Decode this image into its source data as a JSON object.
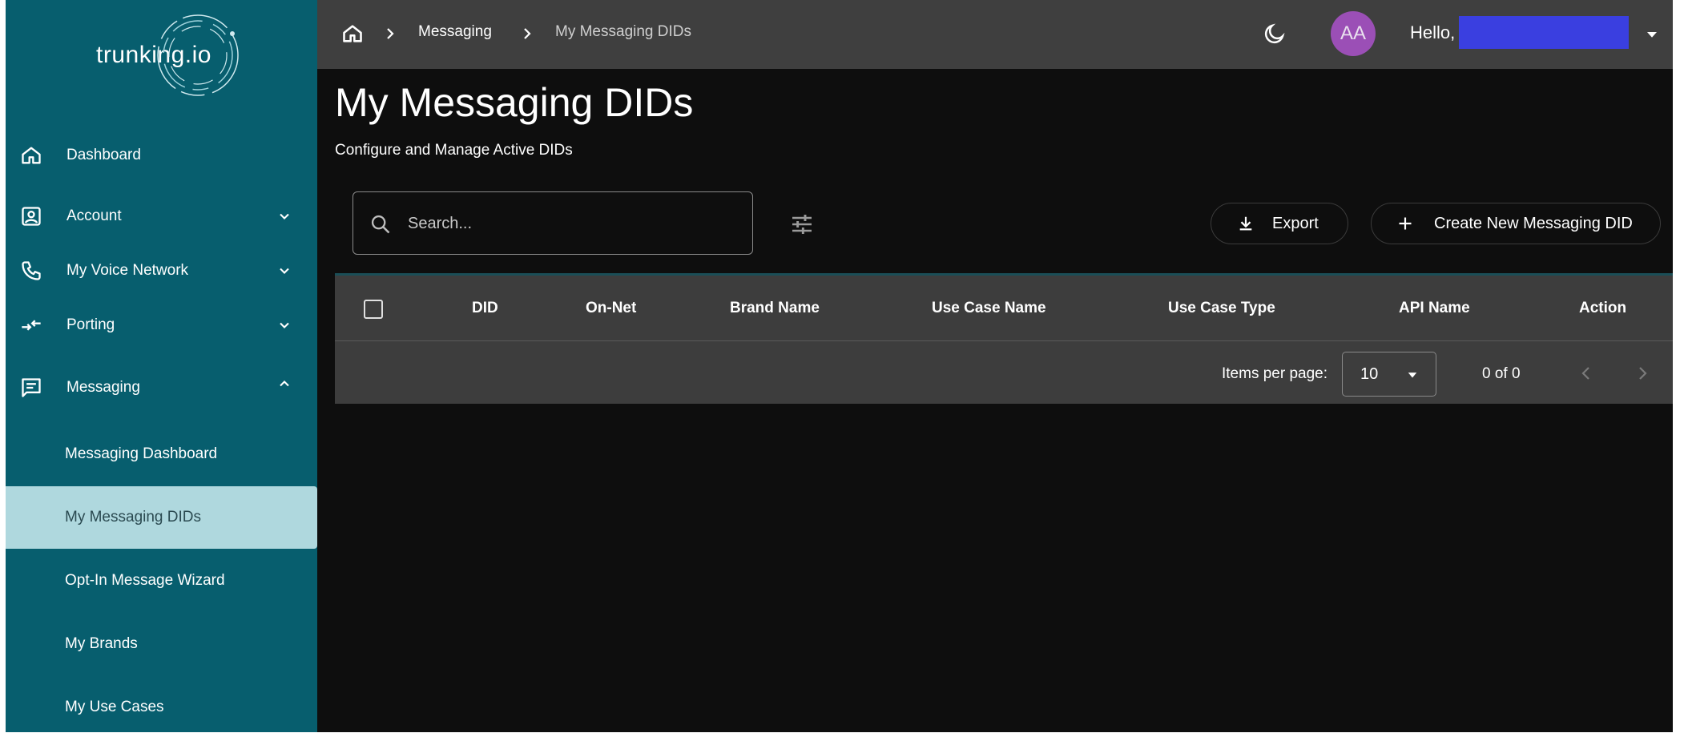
{
  "brand": {
    "logo_text": "trunking.io"
  },
  "sidebar": {
    "items": [
      {
        "label": "Dashboard",
        "icon": "home-icon"
      },
      {
        "label": "Account",
        "icon": "account-icon",
        "expandable": true,
        "expanded": false
      },
      {
        "label": "My Voice Network",
        "icon": "phone-icon",
        "expandable": true,
        "expanded": false
      },
      {
        "label": "Porting",
        "icon": "porting-arrows-icon",
        "expandable": true,
        "expanded": false
      },
      {
        "label": "Messaging",
        "icon": "message-icon",
        "expandable": true,
        "expanded": true
      }
    ],
    "sub_items": [
      {
        "label": "Messaging Dashboard",
        "active": false
      },
      {
        "label": "My Messaging DIDs",
        "active": true
      },
      {
        "label": "Opt-In Message Wizard",
        "active": false
      },
      {
        "label": "My Brands",
        "active": false
      },
      {
        "label": "My Use Cases",
        "active": false
      }
    ]
  },
  "header": {
    "breadcrumb": [
      "Messaging",
      "My Messaging DIDs"
    ],
    "avatar_initials": "AA",
    "greeting": "Hello,"
  },
  "page": {
    "title": "My Messaging DIDs",
    "subtitle": "Configure and Manage Active DIDs"
  },
  "toolbar": {
    "search_placeholder": "Search...",
    "export_label": "Export",
    "create_label": "Create New Messaging DID"
  },
  "table": {
    "columns": [
      "DID",
      "On-Net",
      "Brand Name",
      "Use Case Name",
      "Use Case Type",
      "API Name",
      "Action"
    ],
    "rows": []
  },
  "pagination": {
    "items_per_page_label": "Items per page:",
    "items_per_page": "10",
    "range": "0 of 0"
  },
  "colors": {
    "sidebar_bg": "#075e6e",
    "active_item_bg": "#afd8de",
    "topbar_bg": "#3f3f3f",
    "main_bg": "#0e0e0e",
    "avatar_bg": "#9b4fb6"
  }
}
